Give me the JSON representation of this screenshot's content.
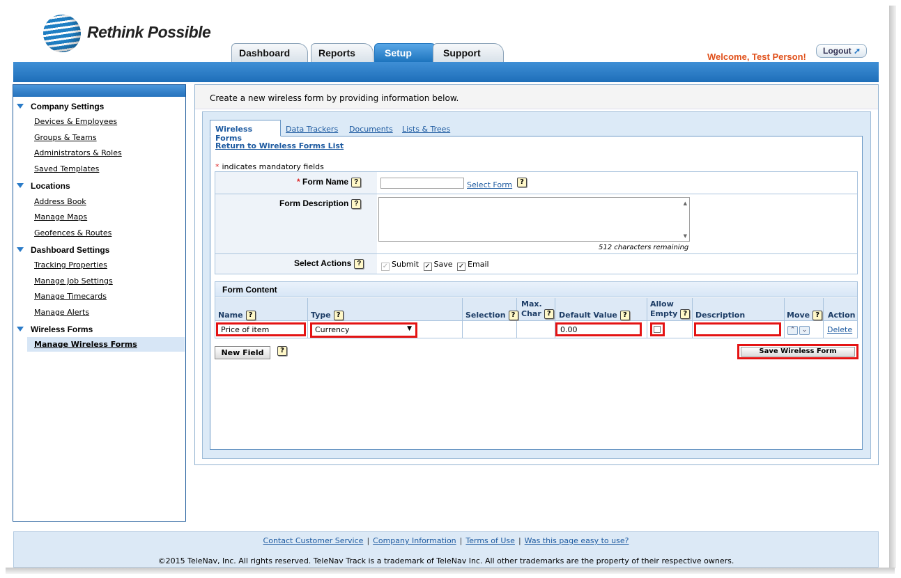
{
  "header": {
    "brand": "Rethink Possible",
    "tabs": [
      "Dashboard",
      "Reports",
      "Setup",
      "Support"
    ],
    "active_tab": "Setup",
    "welcome": "Welcome, Test Person!",
    "logout_label": "Logout"
  },
  "sidebar": {
    "sections": [
      {
        "title": "Company Settings",
        "items": [
          "Devices & Employees",
          "Groups & Teams",
          "Administrators & Roles",
          "Saved Templates"
        ]
      },
      {
        "title": "Locations",
        "items": [
          "Address Book",
          "Manage Maps",
          "Geofences & Routes"
        ]
      },
      {
        "title": "Dashboard Settings",
        "items": [
          "Tracking Properties",
          "Manage Job Settings",
          "Manage Timecards",
          "Manage Alerts"
        ]
      },
      {
        "title": "Wireless Forms",
        "items": [
          "Manage Wireless Forms"
        ]
      }
    ]
  },
  "main": {
    "intro": "Create a new wireless form by providing information below.",
    "subtabs": [
      "Wireless Forms",
      "Data Trackers",
      "Documents",
      "Lists & Trees"
    ],
    "return_link": "Return to Wireless Forms List",
    "mandatory_note": "indicates mandatory fields",
    "form": {
      "name_label": "Form Name",
      "name_value": "",
      "select_form_link": "Select Form",
      "description_label": "Form Description",
      "description_value": "",
      "chars_remaining": "512 characters remaining",
      "actions_label": "Select Actions",
      "actions": [
        {
          "label": "Submit",
          "checked": true,
          "disabled": true
        },
        {
          "label": "Save",
          "checked": true,
          "disabled": false
        },
        {
          "label": "Email",
          "checked": true,
          "disabled": false
        }
      ]
    },
    "content": {
      "title": "Form Content",
      "columns": {
        "name": "Name",
        "type": "Type",
        "selection": "Selection",
        "max_char_1": "Max.",
        "max_char_2": "Char",
        "default_value": "Default Value",
        "allow_empty_1": "Allow",
        "allow_empty_2": "Empty",
        "description": "Description",
        "move": "Move",
        "action": "Action"
      },
      "row": {
        "name": "Price of item",
        "type": "Currency",
        "selection": "",
        "max_char": "",
        "default_value": "0.00",
        "allow_empty": false,
        "description": "",
        "delete_label": "Delete"
      }
    },
    "new_field_label": "New Field",
    "save_label": "Save Wireless Form"
  },
  "footer": {
    "links": [
      "Contact Customer Service",
      "Company Information",
      "Terms of Use",
      "Was this page easy to use?"
    ],
    "copyright": "©2015 TeleNav, Inc. All rights reserved. TeleNav Track is a trademark of TeleNav Inc. All other trademarks are the property of their respective owners."
  },
  "colors": {
    "brand_blue": "#1e6eb8",
    "welcome_orange": "#e0501a",
    "highlight_red": "#e41313",
    "link_blue": "#1d5aa0"
  }
}
